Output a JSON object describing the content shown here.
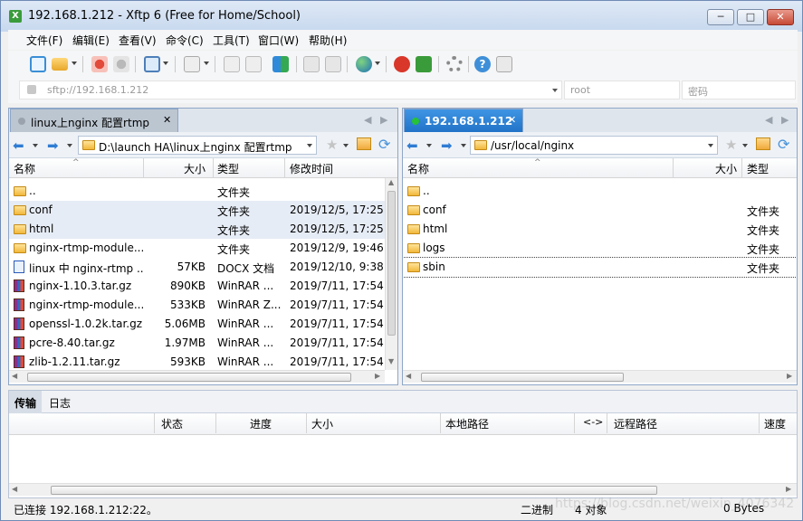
{
  "window": {
    "title": "192.168.1.212 - Xftp 6 (Free for Home/School)",
    "app_icon_letter": "X",
    "minimize_symbol": "─",
    "maximize_symbol": "□",
    "close_symbol": "✕"
  },
  "menu": [
    "文件(F)",
    "编辑(E)",
    "查看(V)",
    "命令(C)",
    "工具(T)",
    "窗口(W)",
    "帮助(H)"
  ],
  "address": {
    "url_placeholder": "sftp://192.168.1.212",
    "user_placeholder": "root",
    "password_placeholder": "密码"
  },
  "left_pane": {
    "tab_title": "linux上nginx 配置rtmp",
    "tab_close": "✕",
    "path": "D:\\launch HA\\linux上nginx 配置rtmp",
    "columns": [
      "名称",
      "大小",
      "类型",
      "修改时间"
    ],
    "files": [
      {
        "name": "..",
        "size": "",
        "type": "文件夹",
        "modified": "",
        "icon": "folder"
      },
      {
        "name": "conf",
        "size": "",
        "type": "文件夹",
        "modified": "2019/12/5, 17:25",
        "icon": "folder"
      },
      {
        "name": "html",
        "size": "",
        "type": "文件夹",
        "modified": "2019/12/5, 17:25",
        "icon": "folder"
      },
      {
        "name": "nginx-rtmp-module...",
        "size": "",
        "type": "文件夹",
        "modified": "2019/12/9, 19:46",
        "icon": "folder"
      },
      {
        "name": "linux 中 nginx-rtmp ...",
        "size": "57KB",
        "type": "DOCX 文档",
        "modified": "2019/12/10, 9:38",
        "icon": "docx"
      },
      {
        "name": "nginx-1.10.3.tar.gz",
        "size": "890KB",
        "type": "WinRAR ...",
        "modified": "2019/7/11, 17:54",
        "icon": "rar"
      },
      {
        "name": "nginx-rtmp-module...",
        "size": "533KB",
        "type": "WinRAR Z...",
        "modified": "2019/7/11, 17:54",
        "icon": "rar"
      },
      {
        "name": "openssl-1.0.2k.tar.gz",
        "size": "5.06MB",
        "type": "WinRAR ...",
        "modified": "2019/7/11, 17:54",
        "icon": "rar"
      },
      {
        "name": "pcre-8.40.tar.gz",
        "size": "1.97MB",
        "type": "WinRAR ...",
        "modified": "2019/7/11, 17:54",
        "icon": "rar"
      },
      {
        "name": "zlib-1.2.11.tar.gz",
        "size": "593KB",
        "type": "WinRAR ...",
        "modified": "2019/7/11, 17:54",
        "icon": "rar"
      }
    ]
  },
  "right_pane": {
    "tab_title": "192.168.1.212",
    "tab_close": "✕",
    "path": "/usr/local/nginx",
    "columns": [
      "名称",
      "大小",
      "类型"
    ],
    "files": [
      {
        "name": "..",
        "size": "",
        "type": "",
        "icon": "folder"
      },
      {
        "name": "conf",
        "size": "",
        "type": "文件夹",
        "icon": "folder"
      },
      {
        "name": "html",
        "size": "",
        "type": "文件夹",
        "icon": "folder"
      },
      {
        "name": "logs",
        "size": "",
        "type": "文件夹",
        "icon": "folder"
      },
      {
        "name": "sbin",
        "size": "",
        "type": "文件夹",
        "icon": "folder"
      }
    ]
  },
  "transfer": {
    "tabs": [
      "传输",
      "日志"
    ],
    "columns": [
      "状态",
      "进度",
      "大小",
      "本地路径",
      "<->",
      "远程路径",
      "速度"
    ]
  },
  "status": {
    "connection": "已连接 192.168.1.212:22。",
    "mode": "二进制",
    "objects": "4 对象",
    "bytes": "0 Bytes"
  },
  "watermark": "https://blog.csdn.net/weixin_4076342",
  "colors": {
    "active_tab": "#2173c7",
    "connected_dot": "#27c235",
    "selection": "#e6ecf5"
  },
  "icons": [
    "new-session-icon",
    "open-folder-icon",
    "disconnect-icon",
    "reconnect-icon",
    "transfer-icon",
    "globe-icon",
    "xshell-icon",
    "xftp-icon",
    "settings-icon",
    "help-icon",
    "chat-icon",
    "back-icon",
    "forward-icon",
    "bookmark-icon",
    "home-icon",
    "refresh-icon"
  ]
}
